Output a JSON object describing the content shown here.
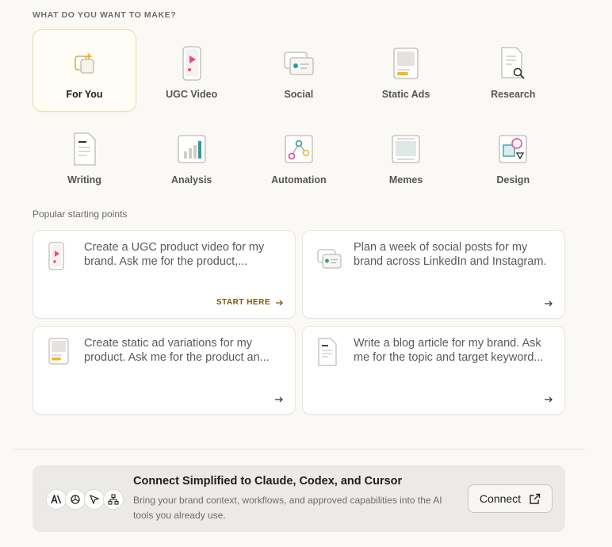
{
  "header": {
    "label": "WHAT DO YOU WANT TO MAKE?"
  },
  "categories": [
    {
      "label": "For You",
      "icon": "sparkle-cards-icon",
      "active": true
    },
    {
      "label": "UGC Video",
      "icon": "phone-video-icon"
    },
    {
      "label": "Social",
      "icon": "social-post-icon"
    },
    {
      "label": "Static Ads",
      "icon": "static-ad-icon"
    },
    {
      "label": "Research",
      "icon": "document-search-icon"
    },
    {
      "label": "Writing",
      "icon": "document-lines-icon"
    },
    {
      "label": "Analysis",
      "icon": "bar-chart-icon"
    },
    {
      "label": "Automation",
      "icon": "workflow-nodes-icon"
    },
    {
      "label": "Memes",
      "icon": "meme-frame-icon"
    },
    {
      "label": "Design",
      "icon": "shapes-icon"
    }
  ],
  "popular": {
    "label": "Popular starting points"
  },
  "cards": [
    {
      "text": "Create a UGC product video for my brand. Ask me for the product,...",
      "cta": "START HERE",
      "icon": "phone-video-icon"
    },
    {
      "text": "Plan a week of social posts for my brand across LinkedIn and Instagram.",
      "cta": "",
      "icon": "social-post-icon"
    },
    {
      "text": "Create static ad variations for my product. Ask me for the product an...",
      "cta": "",
      "icon": "static-ad-icon"
    },
    {
      "text": "Write a blog article for my brand. Ask me for the topic and target keyword...",
      "cta": "",
      "icon": "document-lines-icon"
    }
  ],
  "connect": {
    "title": "Connect Simplified to Claude, Codex, and Cursor",
    "description": "Bring your brand context, workflows, and approved capabilities into the AI tools you already use.",
    "button": "Connect",
    "logos": [
      {
        "name": "anthropic-logo-icon",
        "text": "A\\"
      },
      {
        "name": "openai-logo-icon",
        "text": ""
      },
      {
        "name": "cursor-logo-icon",
        "text": ""
      },
      {
        "name": "network-logo-icon",
        "text": ""
      }
    ]
  },
  "colors": {
    "accent": "#f2b81c",
    "pink": "#e8488f",
    "teal": "#2a9c9c"
  }
}
